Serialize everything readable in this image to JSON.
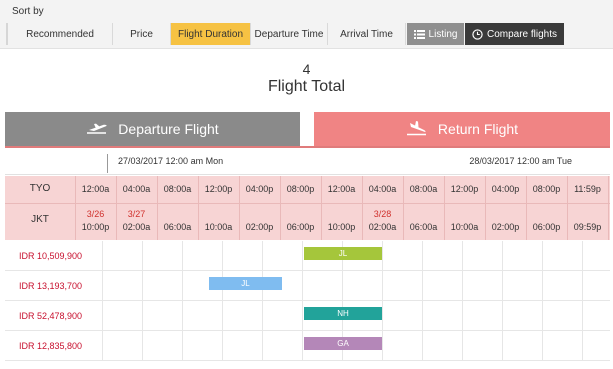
{
  "sort": {
    "label": "Sort by",
    "options": [
      {
        "label": "Recommended",
        "active": false
      },
      {
        "label": "Price",
        "active": false
      },
      {
        "label": "Flight Duration",
        "active": true
      },
      {
        "label": "Departure Time",
        "active": false
      },
      {
        "label": "Arrival Time",
        "active": false
      }
    ],
    "listing_label": "Listing",
    "listing_icon": "list-icon",
    "compare_label": "Compare flights",
    "compare_icon": "clock-icon"
  },
  "summary": {
    "count": "4",
    "label": "Flight Total"
  },
  "tabs": {
    "departure": {
      "label": "Departure Flight",
      "icon": "plane-takeoff-icon",
      "active": false
    },
    "return": {
      "label": "Return Flight",
      "icon": "plane-landing-icon",
      "active": true
    }
  },
  "dates": {
    "start": "27/03/2017 12:00 am Mon",
    "end": "28/03/2017 12:00 am Tue"
  },
  "timeline": {
    "origin": {
      "code": "TYO",
      "times": [
        "12:00a",
        "04:00a",
        "08:00a",
        "12:00p",
        "04:00p",
        "08:00p",
        "12:00a",
        "04:00a",
        "08:00a",
        "12:00p",
        "04:00p",
        "08:00p",
        "11:59p"
      ]
    },
    "destination": {
      "code": "JKT",
      "times": [
        "10:00p",
        "02:00a",
        "06:00a",
        "10:00a",
        "02:00p",
        "06:00p",
        "10:00p",
        "02:00a",
        "06:00a",
        "10:00a",
        "02:00p",
        "06:00p",
        "09:59p"
      ],
      "date_marks": [
        "3/26",
        "3/27",
        "",
        "",
        "",
        "",
        "",
        "3/28",
        "",
        "",
        "",
        "",
        ""
      ]
    }
  },
  "flights": [
    {
      "price": "IDR 10,509,900",
      "airline": "JL",
      "color": "#a5c63b",
      "depart_hour": 20.0,
      "arrive_hour": 28.0
    },
    {
      "price": "IDR 13,193,700",
      "airline": "JL",
      "color": "#7fbcf0",
      "depart_hour": 10.5,
      "arrive_hour": 18.0
    },
    {
      "price": "IDR 52,478,900",
      "airline": "NH",
      "color": "#22a39a",
      "depart_hour": 20.0,
      "arrive_hour": 28.0
    },
    {
      "price": "IDR 12,835,800",
      "airline": "GA",
      "color": "#b487b8",
      "depart_hour": 20.0,
      "arrive_hour": 28.0
    }
  ],
  "colors": {
    "sort_active": "#f6c243",
    "return_tab": "#f08484",
    "departure_tab": "#8a8a8a",
    "price_text": "#c8102e",
    "timeline_bg": "#f7d4d4"
  }
}
